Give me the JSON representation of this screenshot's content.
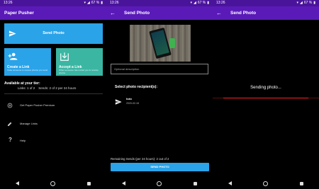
{
  "status_bar": {
    "time": "13:26",
    "battery": "67 %"
  },
  "screen1": {
    "app_title": "Paper Pusher",
    "send_photo": "Send Photo",
    "create_link": {
      "title": "Create a Link",
      "description": "Invite someone to receive photos you send"
    },
    "accept_link": {
      "title": "Accept a Link",
      "description": "When someone has invited you to receive photos"
    },
    "tier_heading": "Available at your tier:",
    "links_limit": "Links: 1 of 2",
    "sends_limit": "Sends: 2 of 2 per 24 hours",
    "menu": [
      {
        "label": "Get Paper Pusher Premium",
        "icon": "premium-icon"
      },
      {
        "label": "Manage Links",
        "icon": "edit-link-icon"
      },
      {
        "label": "Help",
        "icon": "help-icon"
      }
    ]
  },
  "screen2": {
    "title": "Send Photo",
    "description_placeholder": "Optional description",
    "select_label": "Select photo recipient(s):",
    "recipient": {
      "name": "Iván",
      "date": "2020-02-18"
    },
    "remaining": "Remaining Sends (per 24 hours): 2 out of 2",
    "send_button": "SEND PHOTO"
  },
  "screen3": {
    "title": "Send Photo",
    "sending_text": "Sending photo...",
    "progress_fraction": 0.8
  },
  "colors": {
    "status_bar": "#4a149a",
    "app_bar": "#5a1ab8",
    "blue_tile": "#2aa3e8",
    "teal_tile": "#3bb6a3",
    "progress": "#ff2020"
  }
}
